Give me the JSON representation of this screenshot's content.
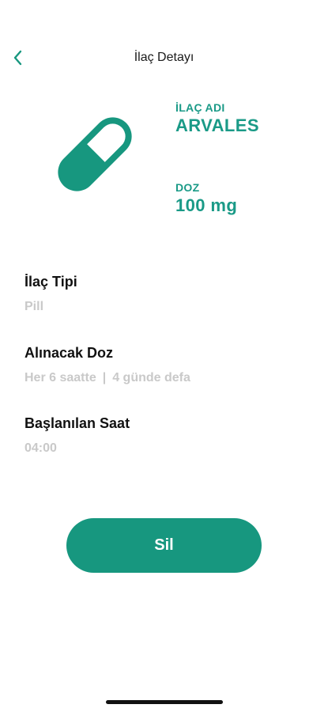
{
  "header": {
    "title": "İlaç Detayı"
  },
  "medicine": {
    "name_label": "İLAÇ ADI",
    "name": "ARVALES",
    "dose_label": "DOZ",
    "dose": "100 mg",
    "icon": "pill-icon"
  },
  "details": {
    "type_title": "İlaç Tipi",
    "type_value": "Pill",
    "dose_title": "Alınacak Doz",
    "dose_frequency": "Her 6 saatte",
    "dose_separator": "|",
    "dose_count": "4 günde defa",
    "start_title": "Başlanılan Saat",
    "start_value": "04:00"
  },
  "actions": {
    "delete_label": "Sil"
  },
  "colors": {
    "accent": "#17977f",
    "muted_text": "#c9c9c9"
  }
}
